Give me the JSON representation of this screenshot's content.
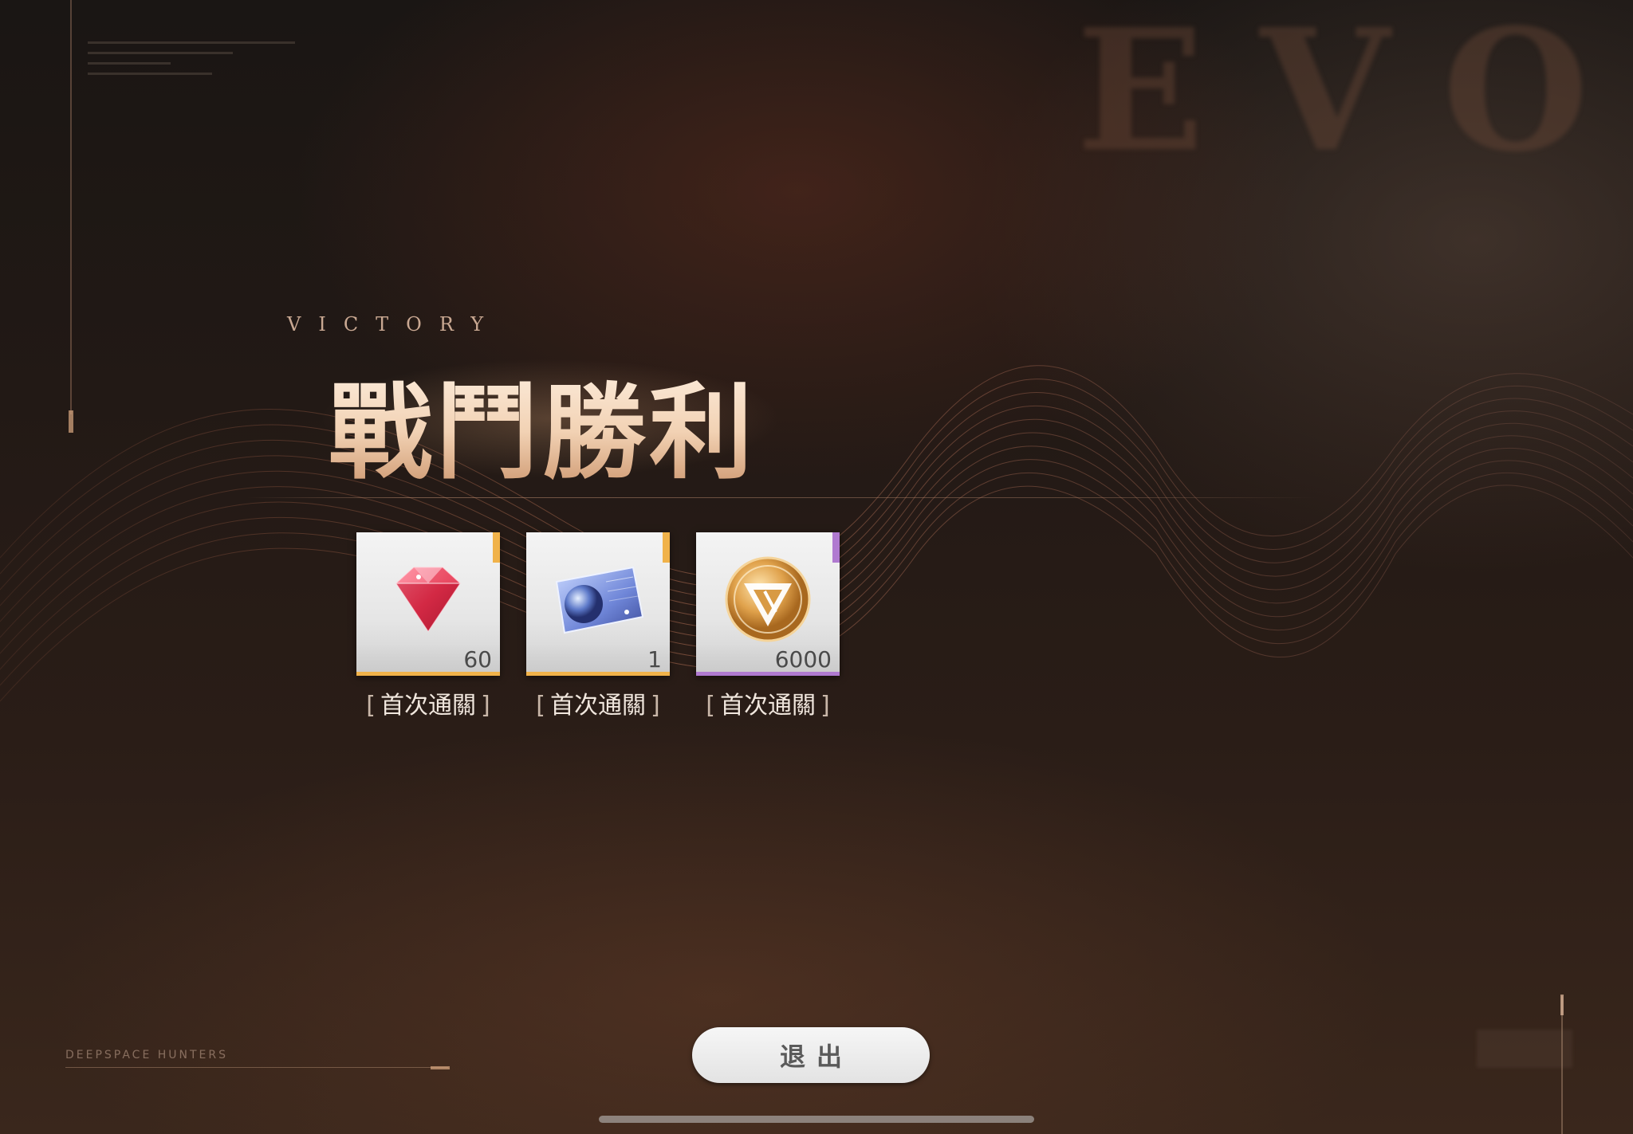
{
  "background": {
    "word": "EVOL",
    "footer_caption": "DEEPSPACE HUNTERS"
  },
  "result": {
    "subtitle": "VICTORY",
    "title": "戰鬥勝利"
  },
  "rewards": [
    {
      "name": "gem-icon",
      "count": "60",
      "label": "首次通關",
      "rarity_color": "#f0b24a"
    },
    {
      "name": "planet-ticket-icon",
      "count": "1",
      "label": "首次通關",
      "rarity_color": "#f0b24a"
    },
    {
      "name": "gold-coin-icon",
      "count": "6000",
      "label": "首次通關",
      "rarity_color": "#b07ad0"
    }
  ],
  "actions": {
    "exit_label": "退出"
  },
  "colors": {
    "accent_gold": "#f0d2b4",
    "button_bg": "#eeeeee"
  }
}
